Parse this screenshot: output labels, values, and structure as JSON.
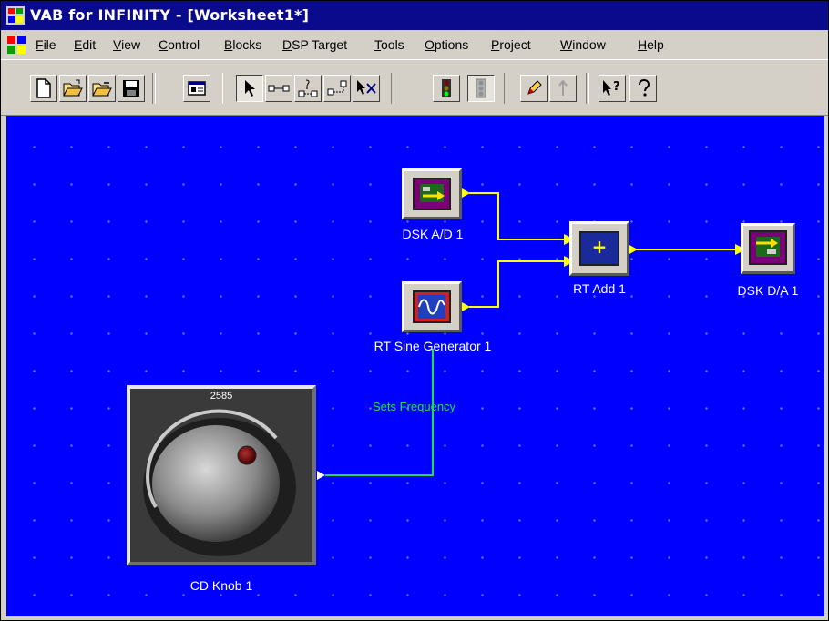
{
  "window": {
    "title": "VAB for INFINITY - [Worksheet1*]",
    "title_bar_color": "#0a0a8c"
  },
  "menu": [
    {
      "pre": "",
      "mn": "F",
      "post": "ile"
    },
    {
      "pre": "",
      "mn": "E",
      "post": "dit"
    },
    {
      "pre": "",
      "mn": "V",
      "post": "iew"
    },
    {
      "pre": "",
      "mn": "C",
      "post": "ontrol"
    },
    {
      "pre": "",
      "mn": "B",
      "post": "locks"
    },
    {
      "pre": "",
      "mn": "D",
      "post": "SP Target"
    },
    {
      "pre": "",
      "mn": "T",
      "post": "ools"
    },
    {
      "pre": "",
      "mn": "O",
      "post": "ptions"
    },
    {
      "pre": "",
      "mn": "P",
      "post": "roject"
    },
    {
      "pre": "",
      "mn": "W",
      "post": "indow"
    },
    {
      "pre": "",
      "mn": "H",
      "post": "elp"
    }
  ],
  "toolbar": {
    "buttons": [
      "new-document-icon",
      "open-folder-icon",
      "save-folder-icon",
      "save-disk-icon",
      "properties-icon",
      "pointer-icon",
      "link-icon",
      "connect-block-icon",
      "connect-port-icon",
      "delete-link-icon",
      "run-traffic-light-icon",
      "stop-icon",
      "pencil-icon",
      "pin-icon",
      "context-help-icon",
      "help-icon"
    ],
    "pressed": [
      "pointer-icon"
    ]
  },
  "canvas": {
    "background_color": "#0000ff",
    "wire_color": "#ffff00",
    "control_wire_color": "#22dd44",
    "blocks": {
      "dsk_ad": {
        "label": "DSK A/D 1"
      },
      "sine_gen": {
        "label": "RT Sine Generator 1"
      },
      "rt_add": {
        "label": "RT Add 1",
        "symbol": "+"
      },
      "dsk_da": {
        "label": "DSK D/A 1"
      },
      "knob": {
        "label": "CD Knob 1",
        "value": "2585"
      }
    },
    "control_link_label": "Sets Frequency"
  }
}
